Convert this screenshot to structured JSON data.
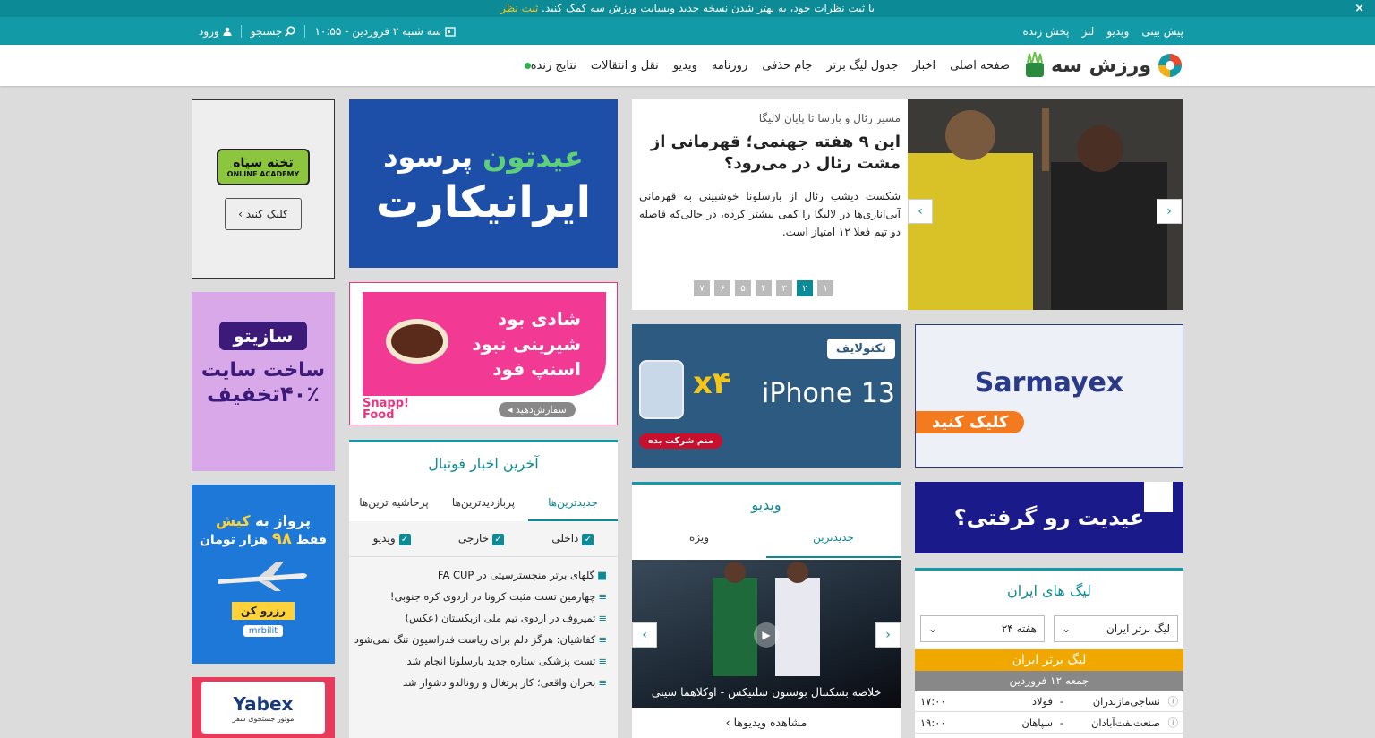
{
  "notice": {
    "text": "با ثبت نظرات خود، به بهتر شدن نسخه جدید وبسایت ورزش سه کمک کنید.",
    "link": "ثبت نظر",
    "close": "×"
  },
  "topbar": {
    "links": [
      "پیش بینی",
      "ویدیو",
      "لنز",
      "پخش زنده"
    ],
    "date": "سه شنبه ۲ فروردین - ۱۰:۵۵",
    "search": "جستجو",
    "login": "ورود"
  },
  "nav": {
    "logo": "ورزش سه",
    "items": [
      "صفحه اصلی",
      "اخبار",
      "جدول لیگ برتر",
      "جام حذفی",
      "روزنامه",
      "ویدیو",
      "نقل و انتقالات",
      "نتایج زنده"
    ]
  },
  "slider": {
    "kicker": "مسیر رئال و بارسا تا پایان لالیگا",
    "title": "این ۹ هفته جهنمی؛ قهرمانی از مشت رئال در می‌رود؟",
    "summary": "شکست دیشب رئال از بارسلونا خوشبینی به قهرمانی آبی‌اناری‌ها در لالیگا را کمی بیشتر کرده، در حالی‌که فاصله دو تیم فعلا ۱۲ امتیاز است.",
    "pages": [
      "۷",
      "۶",
      "۵",
      "۴",
      "۳",
      "۲",
      "۱"
    ],
    "active_page": "۲"
  },
  "ads": {
    "academy": {
      "brand": "تخته سیاه",
      "sub": "ONLINE ACADEMY",
      "button": "کلیک کنید ›"
    },
    "iranicard": {
      "line1a": "عیدتون",
      "line1b": "پرسود",
      "line2": "ایرانیکارت"
    },
    "snappfood": {
      "lines": [
        "شادی بود",
        "شیرینی نبود",
        "اسنپ فود"
      ],
      "brand": "Snapp! Food",
      "button": "سفارش‌دهید ◂"
    },
    "sazito": {
      "brand": "سازیتو",
      "line1": "ساخت سایت",
      "line2": "۴۰٪تخفیف"
    },
    "mrbilit": {
      "line1a": "پرواز به",
      "line1b": "کیش",
      "line2a": "فقط",
      "line2b": "۹۸",
      "line2c": "هزار تومان",
      "button": "رزرو کن",
      "brand": "mrbilit"
    },
    "yabex": {
      "brand": "Yabex",
      "sub": "موتور جستجوی سفر"
    },
    "technolife": {
      "brand": "تکنولایف",
      "model": "iPhone 13",
      "x": "x۴",
      "button": "منم شرکت بده"
    },
    "sarmayex": {
      "brand": "Sarmayex",
      "button": "کلیک کنید"
    },
    "faraz": {
      "text": "عیدیت رو گرفتی؟"
    }
  },
  "football_news": {
    "title": "آخرین اخبار فوتبال",
    "tabs": [
      "جدیدترین‌ها",
      "پربازدیدترین‌ها",
      "پرحاشیه ترین‌ها"
    ],
    "filters": [
      "داخلی",
      "خارجی",
      "ویدیو"
    ],
    "items": [
      "گلهای برتر منچسترسیتی در FA CUP",
      "چهارمین تست مثبت کرونا در اردوی کره جنوبی!",
      "تمیروف در اردوی تیم ملی ازبکستان (عکس)",
      "کفاشیان: هرگز دلم برای ریاست فدراسیون تنگ نمی‌شود",
      "تست پزشکی ستاره جدید بارسلونا انجام شد",
      "بحران واقعی؛ کار پرتغال و رونالدو دشوار شد"
    ]
  },
  "video": {
    "title": "ویدیو",
    "tabs": [
      "جدیدترین",
      "ویژه"
    ],
    "caption": "خلاصه بسکتبال بوستون سلتیکس - اوکلاهما سیتی",
    "more": "مشاهده ویدیوها ›"
  },
  "league": {
    "title": "لیگ های ایران",
    "league_select": "لیگ برتر ایران",
    "week_select": "هفته ۲۴",
    "banner": "لیگ برتر ایران",
    "day": "جمعه ۱۲ فروردین",
    "matches": [
      {
        "home": "نساجی‌مازندران",
        "away": "فولاد",
        "time": "۱۷:۰۰"
      },
      {
        "home": "صنعت‌نفت‌آبادان",
        "away": "سپاهان",
        "time": "۱۹:۰۰"
      }
    ]
  },
  "colors": {
    "accent": "#129aa6",
    "accent_dark": "#0c8a96",
    "live": "#2bb24c",
    "league_banner": "#f0a800"
  }
}
